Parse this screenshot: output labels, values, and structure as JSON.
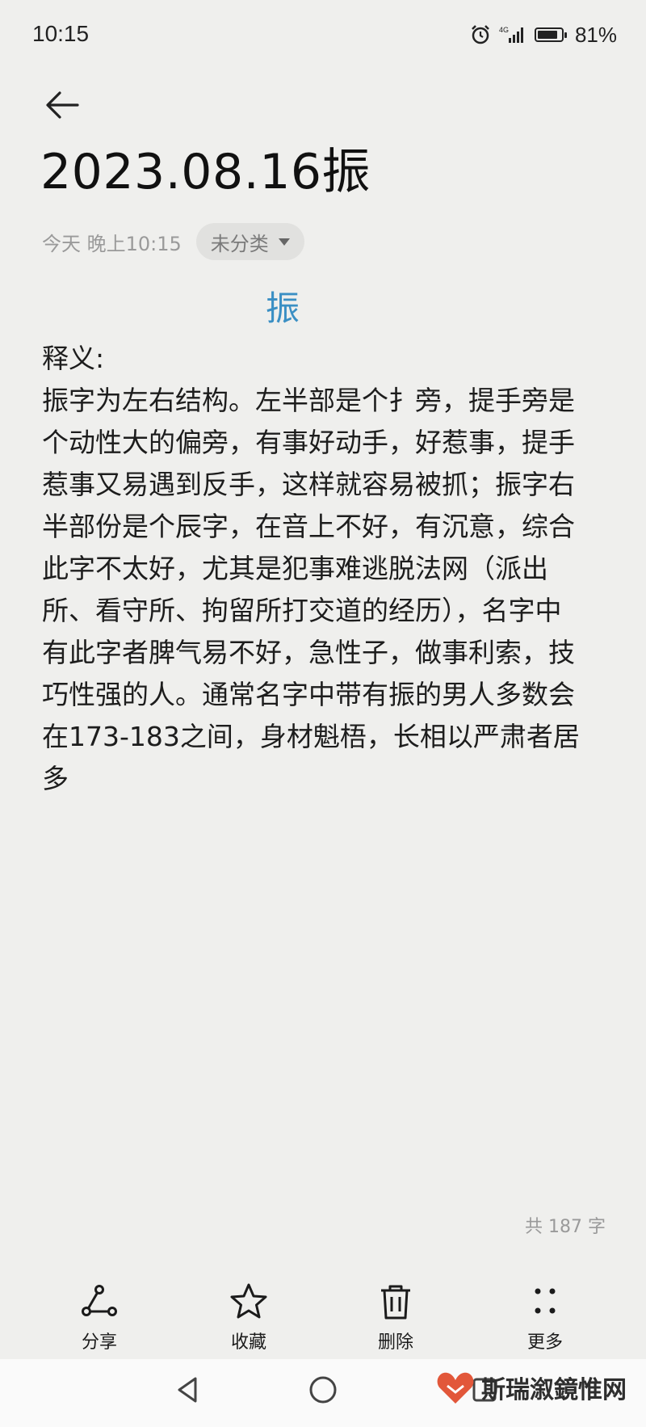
{
  "status_bar": {
    "time": "10:15",
    "battery": "81%"
  },
  "note": {
    "title": "2023.08.16振",
    "meta_time": "今天 晚上10:15",
    "category": "未分类",
    "heading_char": "振",
    "body_lines": [
      "释义:",
      "振字为左右结构。左半部是个扌旁，提手旁是",
      "个动性大的偏旁，有事好动手，好惹事，提手",
      "惹事又易遇到反手，这样就容易被抓；振字右",
      "半部份是个辰字，在音上不好，有沉意，综合",
      "此字不太好，尤其是犯事难逃脱法网（派出",
      "所、看守所、拘留所打交道的经历），名字中",
      "有此字者脾气易不好，急性子，做事利索，技",
      "巧性强的人。通常名字中带有振的男人多数会",
      "在173-183之间，身材魁梧，长相以严肃者居",
      "多"
    ],
    "word_count": "共 187 字"
  },
  "toolbar": {
    "share_label": "分享",
    "favorite_label": "收藏",
    "delete_label": "删除",
    "more_label": "更多"
  },
  "watermark": {
    "text": "斯瑞溆鏡惟网"
  },
  "icons": {
    "back": "back-arrow-icon",
    "share": "share-icon",
    "favorite": "star-icon",
    "delete": "trash-icon",
    "more": "more-dots-icon"
  },
  "colors": {
    "background": "#efefed",
    "accent": "#3a8fc4",
    "text": "#1b1b1b"
  }
}
